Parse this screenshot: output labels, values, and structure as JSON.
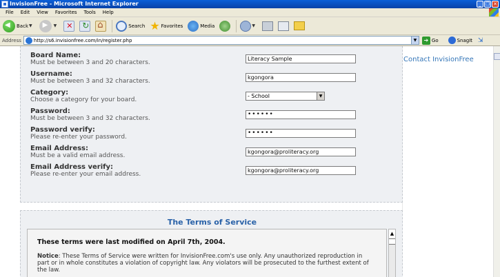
{
  "window": {
    "title": "InvisionFree - Microsoft Internet Explorer",
    "controls": [
      "_",
      "❐",
      "✕"
    ]
  },
  "menu": [
    "File",
    "Edit",
    "View",
    "Favorites",
    "Tools",
    "Help"
  ],
  "toolbar": {
    "back_label": "Back",
    "search_label": "Search",
    "favorites_label": "Favorites",
    "media_label": "Media"
  },
  "address": {
    "label": "Address",
    "url": "http://s6.invisionfree.com/in/register.php",
    "go_label": "Go",
    "snagit_label": "SnagIt"
  },
  "sidebar": {
    "link": "Contact InvisionFree"
  },
  "form": {
    "board_name": {
      "label": "Board Name:",
      "hint": "Must be between 3 and 20 characters.",
      "value": "Literacy Sample"
    },
    "username": {
      "label": "Username:",
      "hint": "Must be between 3 and 32 characters.",
      "value": "kgongora"
    },
    "category": {
      "label": "Category:",
      "hint": "Choose a category for your board.",
      "value": "- School"
    },
    "password": {
      "label": "Password:",
      "hint": "Must be between 3 and 32 characters.",
      "value": "••••••"
    },
    "password_verify": {
      "label": "Password verify:",
      "hint": "Please re-enter your password.",
      "value": "••••••"
    },
    "email": {
      "label": "Email Address:",
      "hint": "Must be a valid email address.",
      "value": "kgongora@proliteracy.org"
    },
    "email_verify": {
      "label": "Email Address verify:",
      "hint": "Please re-enter your email address.",
      "value": "kgongora@proliteracy.org"
    }
  },
  "tos": {
    "title": "The Terms of Service",
    "modified": "These terms were last modified on April 7th, 2004.",
    "notice_label": "Notice",
    "notice_text": ": These Terms of Service were written for InvisionFree.com's use only. Any unauthorized reproduction in part or in whole constitutes a violation of copyright law. Any violators will be prosecuted to the furthest extent of the law."
  }
}
